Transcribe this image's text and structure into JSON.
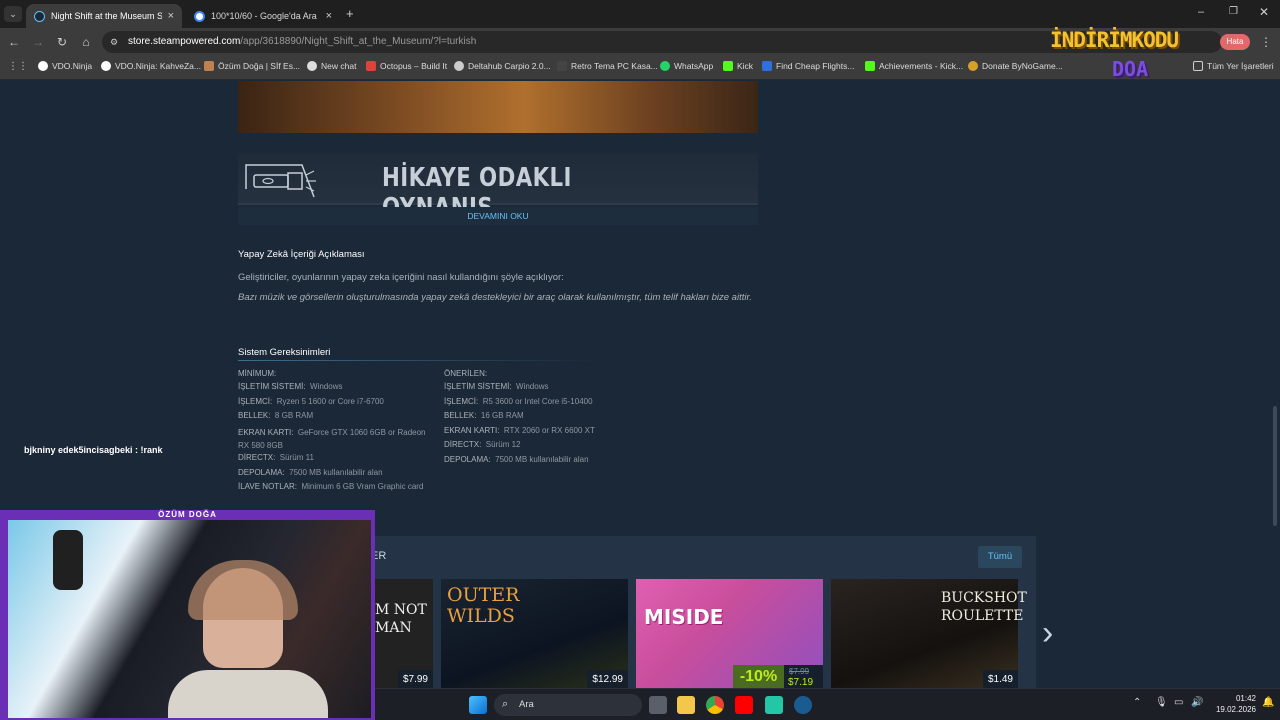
{
  "tabs": [
    {
      "label": "Night Shift at the Museum Steam",
      "active": true
    },
    {
      "label": "100*10/60 - Google'da Ara",
      "active": false
    }
  ],
  "address": {
    "host": "store.steampowered.com",
    "path": "/app/3618890/Night_Shift_at_the_Museum/?l=turkish"
  },
  "bookmarks": [
    "VDO.Ninja",
    "VDO.Ninja: KahveZa...",
    "Özüm Doğa | Sİf Es...",
    "New chat",
    "Octopus – Build It",
    "Deltahub Carpio 2.0...",
    "Retro Tema PC Kasa...",
    "WhatsApp",
    "Kick",
    "Find Cheap Flights...",
    "Achievements - Kick...",
    "Donate ByNoGame...",
    "Tüm Yer İşaretleri"
  ],
  "overlay_logo": {
    "line1": "İNDİRİMKODU",
    "line2": "DOA",
    "pill": "Hata"
  },
  "banner_title": "HİKAYE ODAKLI OYNANIŞ",
  "read_more": "DEVAMINI OKU",
  "ai": {
    "heading": "Yapay Zekâ İçeriği Açıklaması",
    "intro": "Geliştiriciler, oyunlarının yapay zeka içeriğini nasıl kullandığını şöyle açıklıyor:",
    "quote": "Bazı müzik ve görsellerin oluşturulmasında yapay zekâ destekleyici bir araç olarak kullanılmıştır, tüm telif hakları bize aittir."
  },
  "sysreq": {
    "heading": "Sistem Gereksinimleri",
    "min": {
      "title": "MİNİMUM:",
      "rows": [
        {
          "k": "İŞLETİM SİSTEMİ:",
          "v": "Windows"
        },
        {
          "k": "İŞLEMCİ:",
          "v": "Ryzen 5 1600 or Core i7-6700"
        },
        {
          "k": "BELLEK:",
          "v": "8 GB RAM"
        },
        {
          "k": "EKRAN KARTI:",
          "v": "GeForce GTX 1060 6GB or Radeon RX 580 8GB"
        },
        {
          "k": "DİRECTX:",
          "v": "Sürüm 11"
        },
        {
          "k": "DEPOLAMA:",
          "v": "7500 MB kullanılabilir alan"
        },
        {
          "k": "İLAVE NOTLAR:",
          "v": "Minimum 6 GB Vram Graphic card"
        }
      ]
    },
    "rec": {
      "title": "ÖNERİLEN:",
      "rows": [
        {
          "k": "İŞLETİM SİSTEMİ:",
          "v": "Windows"
        },
        {
          "k": "İŞLEMCİ:",
          "v": "R5 3600 or Intel Core i5-10400"
        },
        {
          "k": "BELLEK:",
          "v": "16 GB RAM"
        },
        {
          "k": "EKRAN KARTI:",
          "v": "RTX 2060 or RX 6600 XT"
        },
        {
          "k": "DİRECTX:",
          "v": "Sürüm 12"
        },
        {
          "k": "DEPOLAMA:",
          "v": "7500 MB kullanılabilir alan"
        }
      ]
    }
  },
  "chat_line": "bjkniny edek5incisagbeki : !rank",
  "recs": {
    "heading_tail": "ER",
    "all_button": "Tümü",
    "cards": [
      {
        "title": "M NOT MAN",
        "price": "$7.99"
      },
      {
        "title": "OUTER WILDS",
        "price": "$12.99"
      },
      {
        "title": "MISIDE",
        "discount": "-10%",
        "old_price": "$7.99",
        "price": "$7.19"
      },
      {
        "title": "BUCKSHOT ROULETTE",
        "price": "$1.49"
      }
    ]
  },
  "cam_name": "ÖZÜM DOĞA",
  "taskbar": {
    "search": "Ara",
    "time": "01:42",
    "date": "19.02.2026"
  }
}
